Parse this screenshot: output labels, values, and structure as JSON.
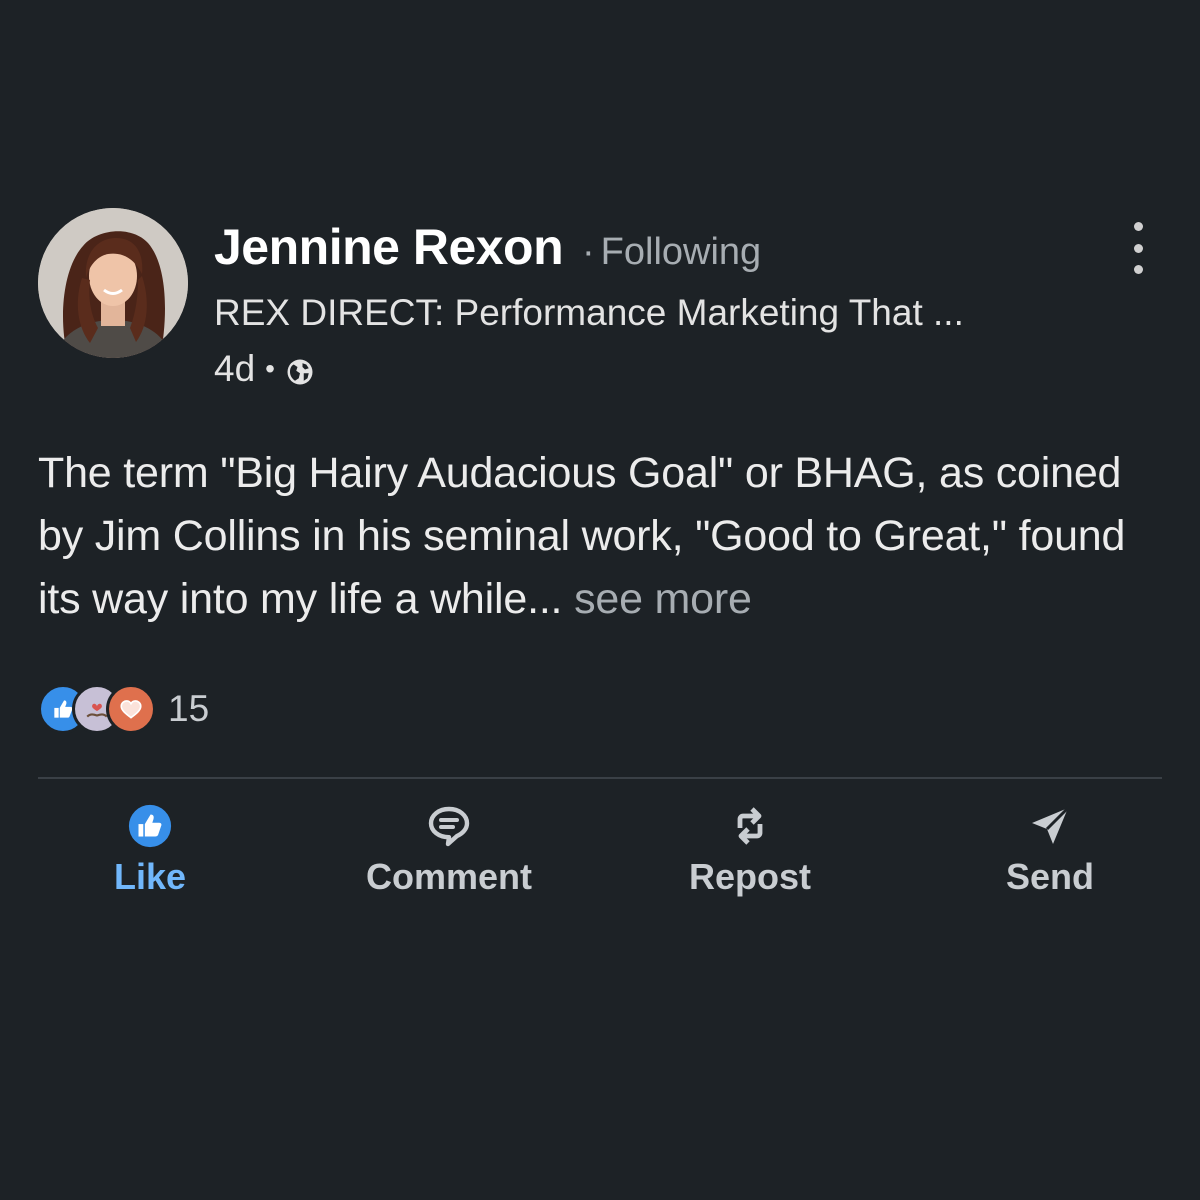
{
  "post": {
    "author": {
      "name": "Jennine Rexon",
      "follow_status": "Following",
      "headline": "REX DIRECT: Performance Marketing That ...",
      "time_ago": "4d",
      "visibility_icon": "globe-icon"
    },
    "body": {
      "text": "The term \"Big Hairy Audacious Goal\" or BHAG, as coined by Jim Collins in his seminal work, \"Good to Great,\" found its way into my life a while...",
      "see_more_label": "see more"
    },
    "reactions": {
      "icons": [
        "like-reaction-icon",
        "support-reaction-icon",
        "love-reaction-icon"
      ],
      "count": "15"
    },
    "actions": {
      "like": {
        "label": "Like",
        "icon": "thumbs-up-icon"
      },
      "comment": {
        "label": "Comment",
        "icon": "comment-icon"
      },
      "repost": {
        "label": "Repost",
        "icon": "repost-icon"
      },
      "send": {
        "label": "Send",
        "icon": "send-icon"
      }
    }
  },
  "colors": {
    "background": "#1d2226",
    "accent": "#71b7fb",
    "muted_text": "#a7adb2"
  }
}
